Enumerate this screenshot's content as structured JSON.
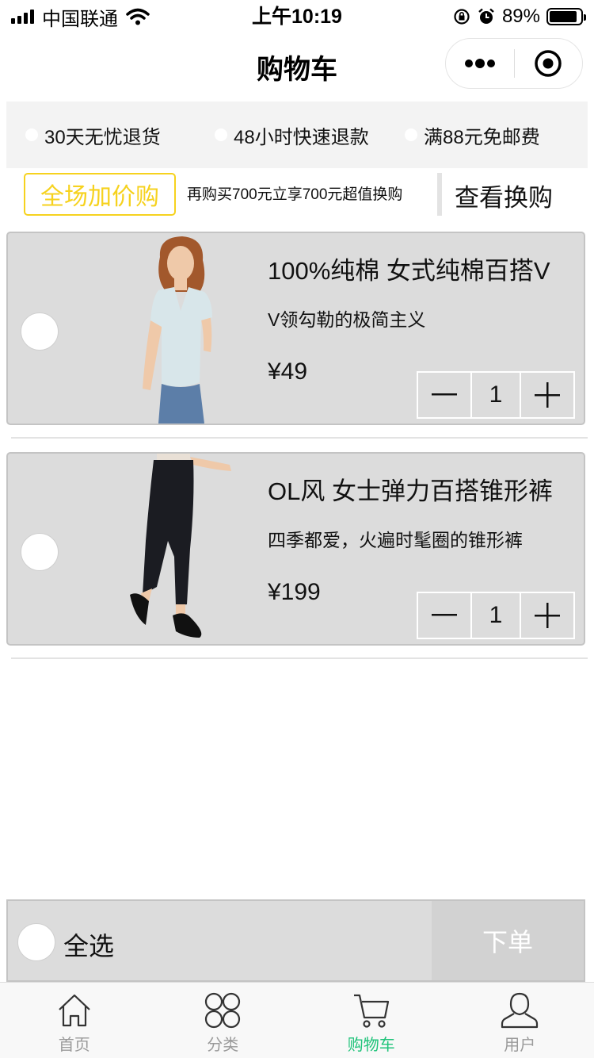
{
  "status_bar": {
    "carrier": "中国联通",
    "time": "上午10:19",
    "battery_percent": "89%",
    "battery_level": 0.89
  },
  "navbar": {
    "title": "购物车"
  },
  "guarantees": [
    {
      "label": "30天无忧退货"
    },
    {
      "label": "48小时快速退款"
    },
    {
      "label": "满88元免邮费"
    }
  ],
  "promo": {
    "tag": "全场加价购",
    "text": "再购买700元立享700元超值换购",
    "link": "查看换购"
  },
  "cart_items": [
    {
      "title": "100%纯棉 女式纯棉百搭V",
      "desc": "V领勾勒的极简主义",
      "price": "¥49",
      "quantity": "1",
      "image_icon": "white-vneck-tshirt-photo"
    },
    {
      "title": "OL风 女士弹力百搭锥形裤",
      "desc": "四季都爱，火遍时髦圈的锥形裤",
      "price": "¥199",
      "quantity": "1",
      "image_icon": "black-tapered-pants-photo"
    }
  ],
  "action_bar": {
    "select_all": "全选",
    "order": "下单"
  },
  "tabbar": [
    {
      "label": "首页",
      "icon": "home-icon",
      "active": false
    },
    {
      "label": "分类",
      "icon": "category-icon",
      "active": false
    },
    {
      "label": "购物车",
      "icon": "cart-icon",
      "active": true
    },
    {
      "label": "用户",
      "icon": "user-icon",
      "active": false
    }
  ],
  "colors": {
    "promo_accent": "#f6d21e",
    "tab_active": "#1fc37a",
    "tab_inactive": "#9a9a9a",
    "card_bg": "#dcdcdc"
  }
}
